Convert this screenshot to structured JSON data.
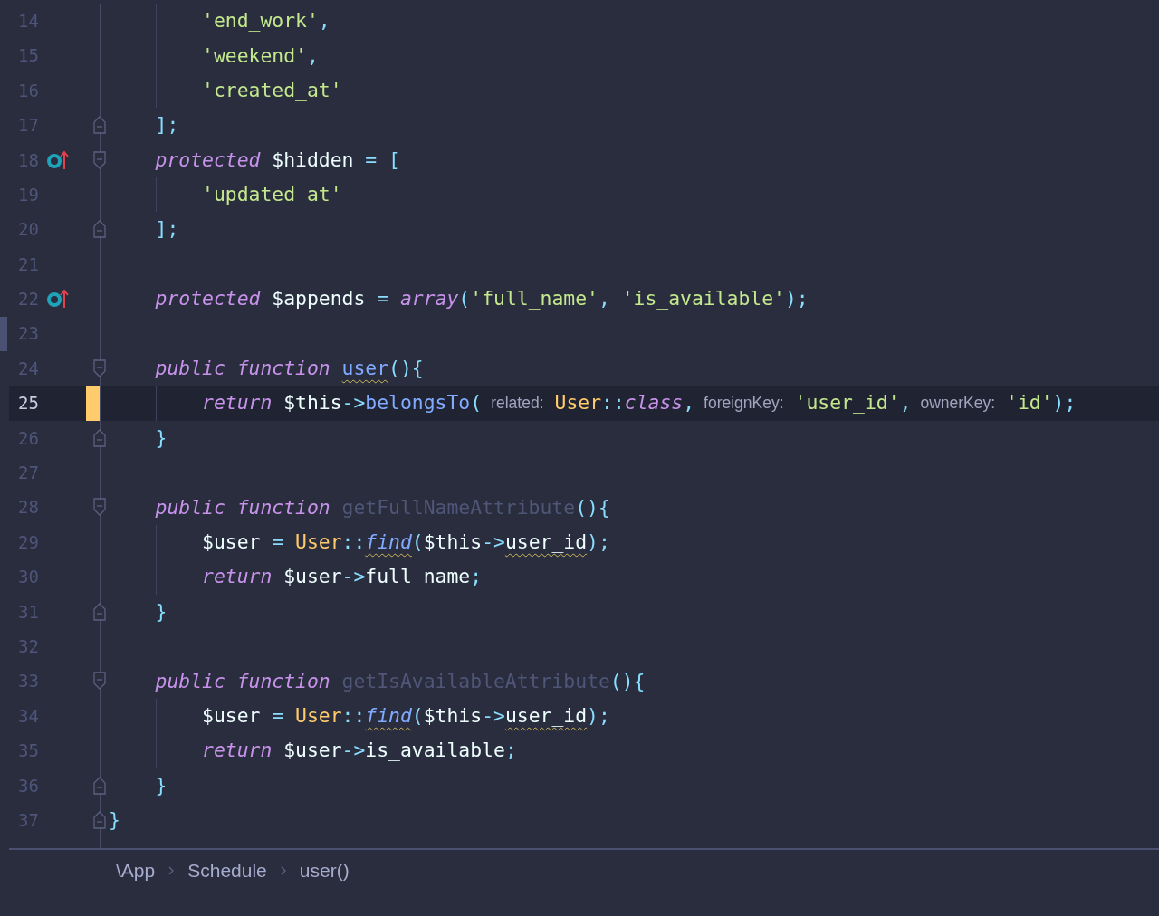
{
  "lines": [
    {
      "number": "14",
      "kind": "statement",
      "fold_start": false,
      "fold_end": false,
      "override": false,
      "modified": false,
      "current": false,
      "edge_marker": false,
      "tokens": [
        {
          "t": "'end_work'",
          "kind": "string"
        },
        {
          "t": ",",
          "kind": "punct"
        }
      ]
    },
    {
      "number": "15",
      "kind": "statement",
      "fold_start": false,
      "fold_end": false,
      "override": false,
      "modified": false,
      "current": false,
      "edge_marker": false,
      "tokens": [
        {
          "t": "'weekend'",
          "kind": "string"
        },
        {
          "t": ",",
          "kind": "punct"
        }
      ]
    },
    {
      "number": "16",
      "kind": "statement",
      "fold_start": false,
      "fold_end": false,
      "override": false,
      "modified": false,
      "current": false,
      "edge_marker": false,
      "tokens": [
        {
          "t": "'created_at'",
          "kind": "string"
        }
      ]
    },
    {
      "number": "17",
      "kind": "member",
      "fold_start": false,
      "fold_end": true,
      "override": false,
      "modified": false,
      "current": false,
      "edge_marker": false,
      "tokens": [
        {
          "t": "];",
          "kind": "punct"
        }
      ]
    },
    {
      "number": "18",
      "kind": "member",
      "fold_start": true,
      "fold_end": false,
      "override": true,
      "modified": false,
      "current": false,
      "edge_marker": false,
      "tokens": [
        {
          "t": "protected",
          "kind": "keyword"
        },
        {
          "t": " $hidden",
          "kind": "plain"
        },
        {
          "t": " = [",
          "kind": "punct"
        }
      ]
    },
    {
      "number": "19",
      "kind": "statement",
      "fold_start": false,
      "fold_end": false,
      "override": false,
      "modified": false,
      "current": false,
      "edge_marker": false,
      "tokens": [
        {
          "t": "'updated_at'",
          "kind": "string"
        }
      ]
    },
    {
      "number": "20",
      "kind": "member",
      "fold_start": false,
      "fold_end": true,
      "override": false,
      "modified": false,
      "current": false,
      "edge_marker": false,
      "tokens": [
        {
          "t": "];",
          "kind": "punct"
        }
      ]
    },
    {
      "number": "21",
      "kind": "blank",
      "fold_start": false,
      "fold_end": false,
      "override": false,
      "modified": false,
      "current": false,
      "edge_marker": false
    },
    {
      "number": "22",
      "kind": "member",
      "fold_start": false,
      "fold_end": false,
      "override": true,
      "modified": false,
      "current": false,
      "edge_marker": false,
      "tokens": [
        {
          "t": "protected",
          "kind": "keyword"
        },
        {
          "t": " $appends",
          "kind": "plain"
        },
        {
          "t": " = ",
          "kind": "punct"
        },
        {
          "t": "array",
          "kind": "keyword"
        },
        {
          "t": "(",
          "kind": "punct"
        },
        {
          "t": "'full_name'",
          "kind": "string"
        },
        {
          "t": ", ",
          "kind": "punct"
        },
        {
          "t": "'is_available'",
          "kind": "string"
        },
        {
          "t": ");",
          "kind": "punct"
        }
      ]
    },
    {
      "number": "23",
      "kind": "blank",
      "fold_start": false,
      "fold_end": false,
      "override": false,
      "modified": false,
      "current": false,
      "edge_marker": true
    },
    {
      "number": "24",
      "kind": "member",
      "fold_start": true,
      "fold_end": false,
      "override": false,
      "modified": false,
      "current": false,
      "edge_marker": false,
      "tokens": [
        {
          "t": "public function ",
          "kind": "keyword"
        },
        {
          "t": "user",
          "kind": "func-warned"
        },
        {
          "t": "(){",
          "kind": "punct"
        }
      ]
    },
    {
      "number": "25",
      "kind": "statement",
      "fold_start": false,
      "fold_end": false,
      "override": false,
      "modified": true,
      "current": true,
      "edge_marker": false,
      "tokens": [
        {
          "t": "return ",
          "kind": "keyword"
        },
        {
          "t": "$this",
          "kind": "plain"
        },
        {
          "t": "->",
          "kind": "punct"
        },
        {
          "t": "belongsTo",
          "kind": "func"
        },
        {
          "t": "(",
          "kind": "punct"
        },
        {
          "t": "related:",
          "kind": "hint"
        },
        {
          "t": "User",
          "kind": "class"
        },
        {
          "t": "::",
          "kind": "punct"
        },
        {
          "t": "class",
          "kind": "keyword"
        },
        {
          "t": ",",
          "kind": "punct"
        },
        {
          "t": "foreignKey:",
          "kind": "hint"
        },
        {
          "t": "'user_id'",
          "kind": "string"
        },
        {
          "t": ",",
          "kind": "punct"
        },
        {
          "t": "ownerKey:",
          "kind": "hint"
        },
        {
          "t": "'id'",
          "kind": "string"
        },
        {
          "t": ");",
          "kind": "punct"
        }
      ]
    },
    {
      "number": "26",
      "kind": "member",
      "fold_start": false,
      "fold_end": true,
      "override": false,
      "modified": false,
      "current": false,
      "edge_marker": false,
      "tokens": [
        {
          "t": "}",
          "kind": "punct"
        }
      ]
    },
    {
      "number": "27",
      "kind": "blank",
      "fold_start": false,
      "fold_end": false,
      "override": false,
      "modified": false,
      "current": false,
      "edge_marker": false
    },
    {
      "number": "28",
      "kind": "member",
      "fold_start": true,
      "fold_end": false,
      "override": false,
      "modified": false,
      "current": false,
      "edge_marker": false,
      "tokens": [
        {
          "t": "public function ",
          "kind": "keyword"
        },
        {
          "t": "getFullNameAttribute",
          "kind": "dim"
        },
        {
          "t": "(){",
          "kind": "punct"
        }
      ]
    },
    {
      "number": "29",
      "kind": "statement",
      "fold_start": false,
      "fold_end": false,
      "override": false,
      "modified": false,
      "current": false,
      "edge_marker": false,
      "tokens": [
        {
          "t": "$user",
          "kind": "plain"
        },
        {
          "t": " = ",
          "kind": "punct"
        },
        {
          "t": "User",
          "kind": "class"
        },
        {
          "t": "::",
          "kind": "punct"
        },
        {
          "t": "find",
          "kind": "func-italic-warned"
        },
        {
          "t": "(",
          "kind": "punct"
        },
        {
          "t": "$this",
          "kind": "plain"
        },
        {
          "t": "->",
          "kind": "punct"
        },
        {
          "t": "user_id",
          "kind": "plain-warned"
        },
        {
          "t": ");",
          "kind": "punct"
        }
      ]
    },
    {
      "number": "30",
      "kind": "statement",
      "fold_start": false,
      "fold_end": false,
      "override": false,
      "modified": false,
      "current": false,
      "edge_marker": false,
      "tokens": [
        {
          "t": "return ",
          "kind": "keyword"
        },
        {
          "t": "$user",
          "kind": "plain"
        },
        {
          "t": "->",
          "kind": "punct"
        },
        {
          "t": "full_name",
          "kind": "plain"
        },
        {
          "t": ";",
          "kind": "punct"
        }
      ]
    },
    {
      "number": "31",
      "kind": "member",
      "fold_start": false,
      "fold_end": true,
      "override": false,
      "modified": false,
      "current": false,
      "edge_marker": false,
      "tokens": [
        {
          "t": "}",
          "kind": "punct"
        }
      ]
    },
    {
      "number": "32",
      "kind": "blank",
      "fold_start": false,
      "fold_end": false,
      "override": false,
      "modified": false,
      "current": false,
      "edge_marker": false
    },
    {
      "number": "33",
      "kind": "member",
      "fold_start": true,
      "fold_end": false,
      "override": false,
      "modified": false,
      "current": false,
      "edge_marker": false,
      "tokens": [
        {
          "t": "public function ",
          "kind": "keyword"
        },
        {
          "t": "getIsAvailableAttribute",
          "kind": "dim"
        },
        {
          "t": "(){",
          "kind": "punct"
        }
      ]
    },
    {
      "number": "34",
      "kind": "statement",
      "fold_start": false,
      "fold_end": false,
      "override": false,
      "modified": false,
      "current": false,
      "edge_marker": false,
      "tokens": [
        {
          "t": "$user",
          "kind": "plain"
        },
        {
          "t": " = ",
          "kind": "punct"
        },
        {
          "t": "User",
          "kind": "class"
        },
        {
          "t": "::",
          "kind": "punct"
        },
        {
          "t": "find",
          "kind": "func-italic-warned"
        },
        {
          "t": "(",
          "kind": "punct"
        },
        {
          "t": "$this",
          "kind": "plain"
        },
        {
          "t": "->",
          "kind": "punct"
        },
        {
          "t": "user_id",
          "kind": "plain-warned"
        },
        {
          "t": ");",
          "kind": "punct"
        }
      ]
    },
    {
      "number": "35",
      "kind": "statement",
      "fold_start": false,
      "fold_end": false,
      "override": false,
      "modified": false,
      "current": false,
      "edge_marker": false,
      "tokens": [
        {
          "t": "return ",
          "kind": "keyword"
        },
        {
          "t": "$user",
          "kind": "plain"
        },
        {
          "t": "->",
          "kind": "punct"
        },
        {
          "t": "is_available",
          "kind": "plain"
        },
        {
          "t": ";",
          "kind": "punct"
        }
      ]
    },
    {
      "number": "36",
      "kind": "member",
      "fold_start": false,
      "fold_end": true,
      "override": false,
      "modified": false,
      "current": false,
      "edge_marker": false,
      "tokens": [
        {
          "t": "}",
          "kind": "punct"
        }
      ]
    },
    {
      "number": "37",
      "kind": "top",
      "fold_start": false,
      "fold_end": true,
      "override": false,
      "modified": false,
      "current": false,
      "edge_marker": false,
      "tokens": [
        {
          "t": "}",
          "kind": "punct"
        }
      ]
    }
  ],
  "breadcrumb": [
    "\\App",
    "Schedule",
    "user()"
  ]
}
